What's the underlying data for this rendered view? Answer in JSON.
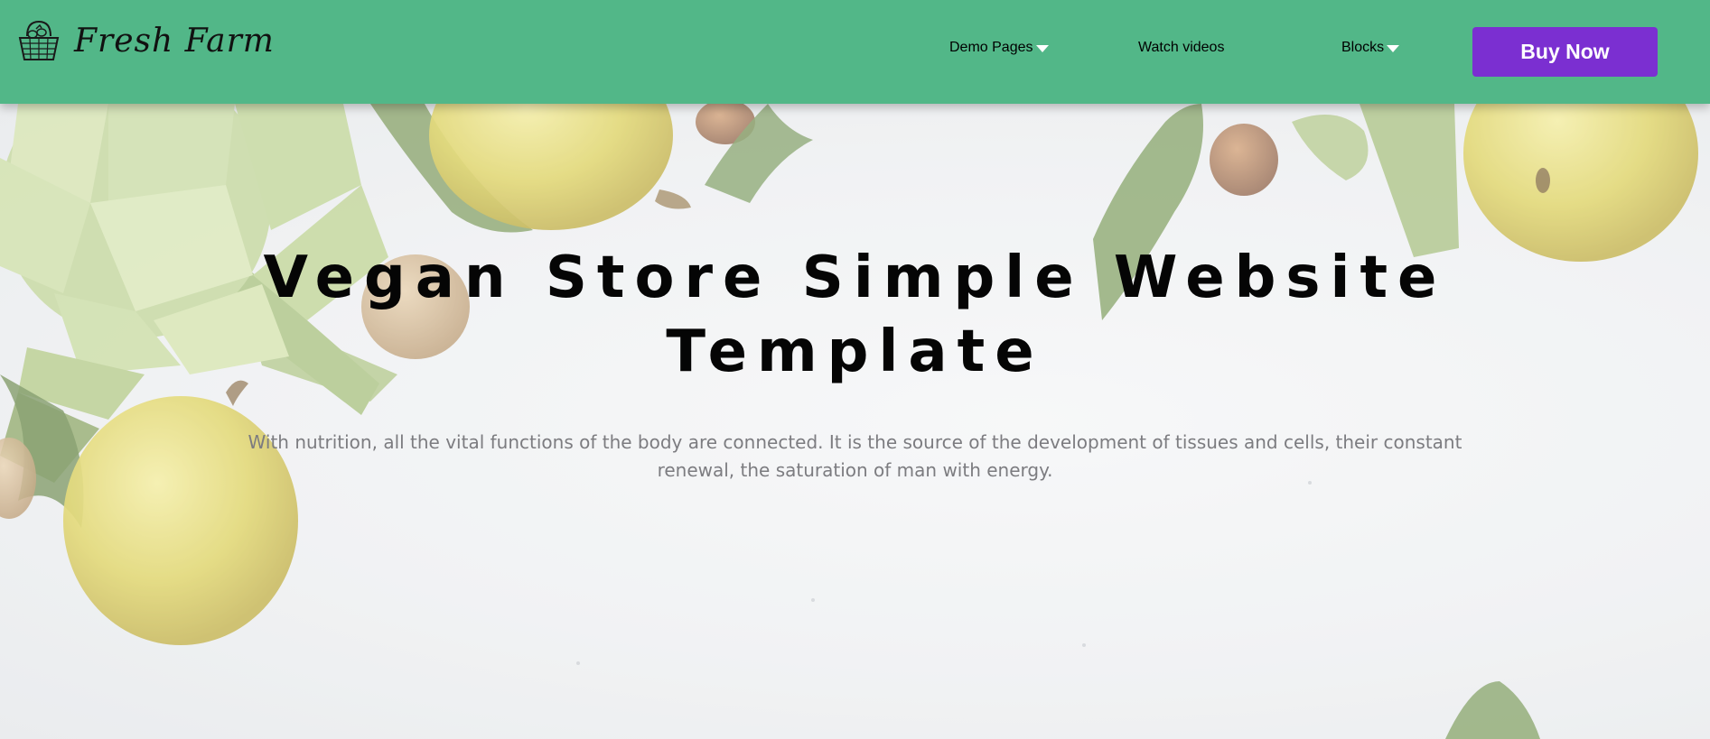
{
  "brand": {
    "name": "Fresh Farm",
    "logo_icon": "basket-icon"
  },
  "nav": {
    "items": [
      {
        "label": "Demo Pages",
        "has_dropdown": true
      },
      {
        "label": "Watch videos",
        "has_dropdown": false
      },
      {
        "label": "Blocks",
        "has_dropdown": true
      }
    ],
    "cta_label": "Buy Now"
  },
  "hero": {
    "title": "Vegan Store Simple Website Template",
    "subtitle": "With nutrition, all the vital functions of the body are connected. It is the source of the development of tissues and cells, their constant renewal, the saturation of man with energy."
  },
  "colors": {
    "header_bg": "#52b788",
    "cta_bg": "#7b2fd1",
    "title_text": "#050505",
    "subtitle_text": "#7c7c80"
  }
}
